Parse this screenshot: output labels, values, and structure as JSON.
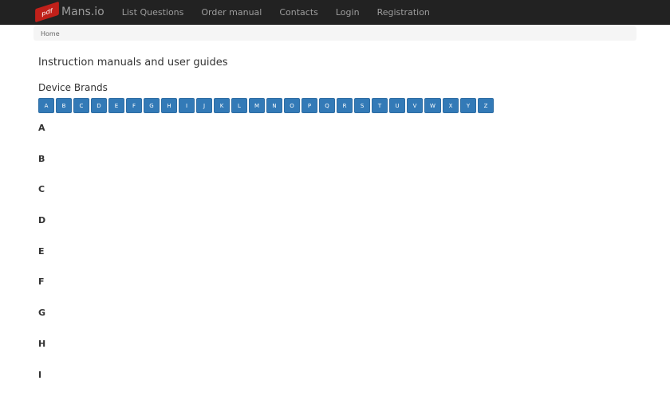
{
  "nav": {
    "brand": "Mans.io",
    "logo_text": "pdf",
    "items": [
      "List Questions",
      "Order manual",
      "Contacts",
      "Login",
      "Registration"
    ]
  },
  "breadcrumb": "Home",
  "title": "Instruction manuals and user guides",
  "subtitle": "Device Brands",
  "letters": [
    "A",
    "B",
    "C",
    "D",
    "E",
    "F",
    "G",
    "H",
    "I",
    "J",
    "K",
    "L",
    "M",
    "N",
    "O",
    "P",
    "Q",
    "R",
    "S",
    "T",
    "U",
    "V",
    "W",
    "X",
    "Y",
    "Z"
  ],
  "sections": [
    "A",
    "B",
    "C",
    "D",
    "E",
    "F",
    "G",
    "H",
    "I"
  ]
}
